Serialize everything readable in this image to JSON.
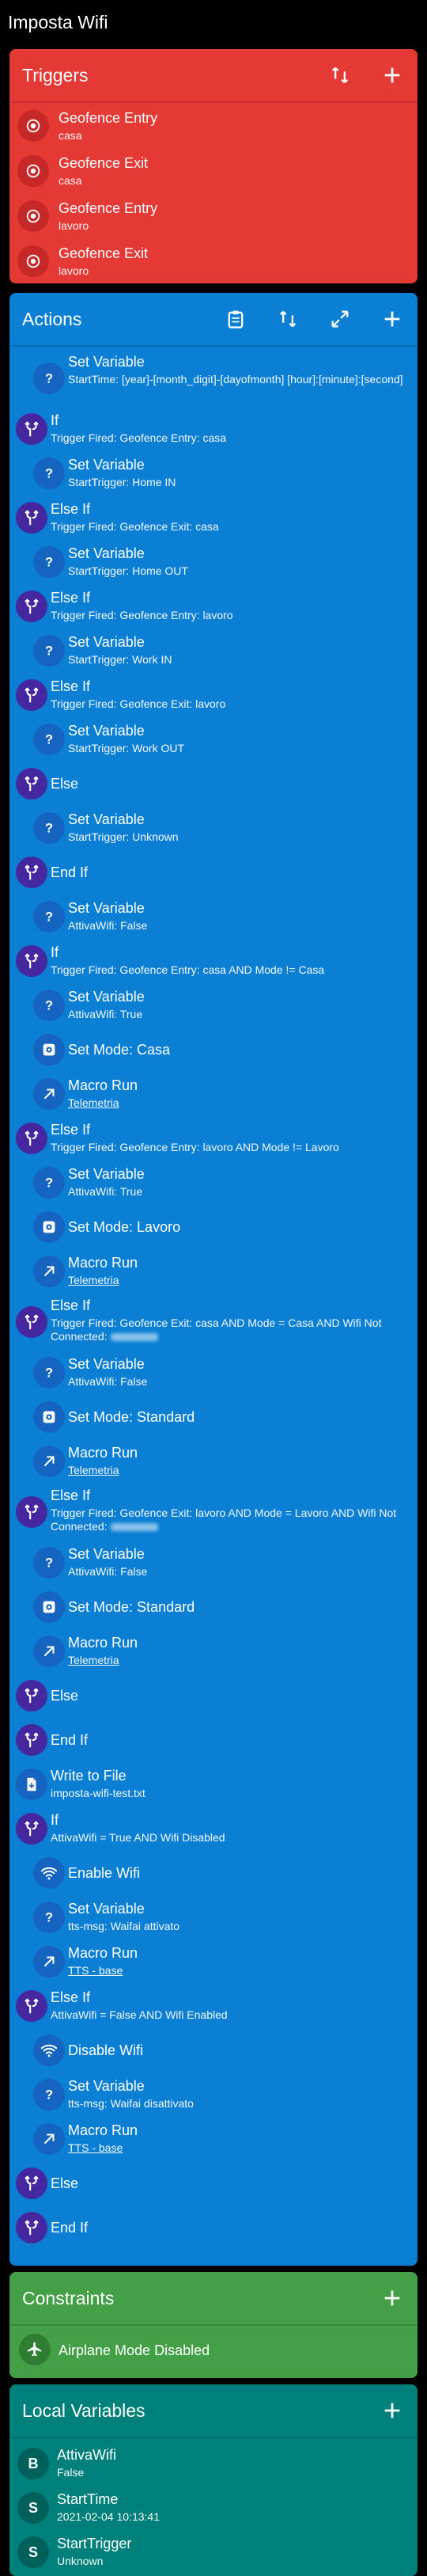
{
  "app": {
    "title": "Imposta Wifi"
  },
  "triggers": {
    "title": "Triggers",
    "items": [
      {
        "label": "Geofence Entry",
        "detail": "casa"
      },
      {
        "label": "Geofence Exit",
        "detail": "casa"
      },
      {
        "label": "Geofence Entry",
        "detail": "lavoro"
      },
      {
        "label": "Geofence Exit",
        "detail": "lavoro"
      }
    ]
  },
  "actions": {
    "title": "Actions",
    "items": [
      {
        "label": "Set Variable",
        "detail": "StartTime: [year]-[month_digit]-[dayofmonth] [hour]:[minute]:[second]",
        "icon": "question-icon"
      },
      {
        "label": "If",
        "detail": "Trigger Fired: Geofence Entry: casa",
        "icon": "branch-icon"
      },
      {
        "label": "Set Variable",
        "detail": "StartTrigger: Home IN",
        "icon": "question-icon"
      },
      {
        "label": "Else If",
        "detail": "Trigger Fired: Geofence Exit: casa",
        "icon": "branch-icon"
      },
      {
        "label": "Set Variable",
        "detail": "StartTrigger: Home OUT",
        "icon": "question-icon"
      },
      {
        "label": "Else If",
        "detail": "Trigger Fired: Geofence Entry: lavoro",
        "icon": "branch-icon"
      },
      {
        "label": "Set Variable",
        "detail": "StartTrigger: Work IN",
        "icon": "question-icon"
      },
      {
        "label": "Else If",
        "detail": "Trigger Fired: Geofence Exit: lavoro",
        "icon": "branch-icon"
      },
      {
        "label": "Set Variable",
        "detail": "StartTrigger: Work OUT",
        "icon": "question-icon"
      },
      {
        "label": "Else",
        "detail": "",
        "icon": "branch-icon"
      },
      {
        "label": "Set Variable",
        "detail": "StartTrigger: Unknown",
        "icon": "question-icon"
      },
      {
        "label": "End If",
        "detail": "",
        "icon": "branch-icon"
      },
      {
        "label": "Set Variable",
        "detail": "AttivaWifi: False",
        "icon": "question-icon"
      },
      {
        "label": "If",
        "detail": "Trigger Fired: Geofence Entry: casa AND Mode != Casa",
        "icon": "branch-icon"
      },
      {
        "label": "Set Variable",
        "detail": "AttivaWifi: True",
        "icon": "question-icon"
      },
      {
        "label": "Set Mode: Casa",
        "detail": "",
        "icon": "mode-icon"
      },
      {
        "label": "Macro Run",
        "detail": "Telemetria",
        "icon": "arrow-icon",
        "link": true
      },
      {
        "label": "Else If",
        "detail": "Trigger Fired: Geofence Entry: lavoro AND Mode != Lavoro",
        "icon": "branch-icon"
      },
      {
        "label": "Set Variable",
        "detail": "AttivaWifi: True",
        "icon": "question-icon"
      },
      {
        "label": "Set Mode: Lavoro",
        "detail": "",
        "icon": "mode-icon"
      },
      {
        "label": "Macro Run",
        "detail": "Telemetria",
        "icon": "arrow-icon",
        "link": true
      },
      {
        "label": "Else If",
        "detail": "Trigger Fired: Geofence Exit: casa AND Mode = Casa AND Wifi Not Connected:",
        "icon": "branch-icon",
        "blur": true
      },
      {
        "label": "Set Variable",
        "detail": "AttivaWifi: False",
        "icon": "question-icon"
      },
      {
        "label": "Set Mode: Standard",
        "detail": "",
        "icon": "mode-icon"
      },
      {
        "label": "Macro Run",
        "detail": "Telemetria",
        "icon": "arrow-icon",
        "link": true
      },
      {
        "label": "Else If",
        "detail": "Trigger Fired: Geofence Exit: lavoro AND Mode = Lavoro AND Wifi Not Connected:",
        "icon": "branch-icon",
        "blur": true
      },
      {
        "label": "Set Variable",
        "detail": "AttivaWifi: False",
        "icon": "question-icon"
      },
      {
        "label": "Set Mode: Standard",
        "detail": "",
        "icon": "mode-icon"
      },
      {
        "label": "Macro Run",
        "detail": "Telemetria",
        "icon": "arrow-icon",
        "link": true
      },
      {
        "label": "Else",
        "detail": "",
        "icon": "branch-icon"
      },
      {
        "label": "End If",
        "detail": "",
        "icon": "branch-icon"
      },
      {
        "label": "Write to File",
        "detail": "imposta-wifi-test.txt",
        "icon": "file-icon"
      },
      {
        "label": "If",
        "detail": "AttivaWifi = True AND Wifi Disabled",
        "icon": "branch-icon"
      },
      {
        "label": "Enable Wifi",
        "detail": "",
        "icon": "wifi-icon"
      },
      {
        "label": "Set Variable",
        "detail": "tts-msg: Waifai attivato",
        "icon": "question-icon"
      },
      {
        "label": "Macro Run",
        "detail": "TTS - base",
        "icon": "arrow-icon",
        "link": true
      },
      {
        "label": "Else If",
        "detail": "AttivaWifi = False AND Wifi Enabled",
        "icon": "branch-icon"
      },
      {
        "label": "Disable Wifi",
        "detail": "",
        "icon": "wifi-icon"
      },
      {
        "label": "Set Variable",
        "detail": "tts-msg: Waifai disattivato",
        "icon": "question-icon"
      },
      {
        "label": "Macro Run",
        "detail": "TTS - base",
        "icon": "arrow-icon",
        "link": true
      },
      {
        "label": "Else",
        "detail": "",
        "icon": "branch-icon"
      },
      {
        "label": "End If",
        "detail": "",
        "icon": "branch-icon"
      }
    ]
  },
  "constraints": {
    "title": "Constraints",
    "items": [
      {
        "label": "Airplane Mode Disabled"
      }
    ]
  },
  "local_variables": {
    "title": "Local Variables",
    "items": [
      {
        "badge": "B",
        "label": "AttivaWifi",
        "detail": "False"
      },
      {
        "badge": "S",
        "label": "StartTime",
        "detail": "2021-02-04 10:13:41"
      },
      {
        "badge": "S",
        "label": "StartTrigger",
        "detail": "Unknown"
      }
    ]
  },
  "colors": {
    "triggers": "#e53935",
    "actions": "#0a7fd4",
    "constraints": "#43a047",
    "local_variables": "#00807a"
  }
}
